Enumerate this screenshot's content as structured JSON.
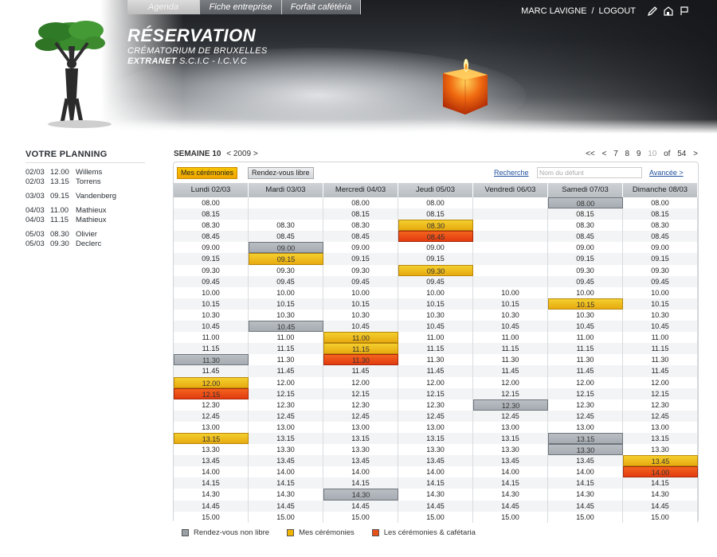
{
  "header": {
    "tabs": [
      "Agenda",
      "Fiche entreprise",
      "Forfait cafétéria"
    ],
    "title": "RÉSERVATION",
    "subtitle1": "CRÉMATORIUM DE BRUXELLES",
    "subtitle2_bold": "EXTRANET",
    "subtitle2_rest": " S.C.I.C - I.C.V.C",
    "user": "MARC LAVIGNE",
    "sep": "/",
    "logout": "LOGOUT"
  },
  "sidebar": {
    "title": "VOTRE PLANNING",
    "groups": [
      [
        {
          "d": "02/03",
          "t": "12.00",
          "n": "Willems"
        },
        {
          "d": "02/03",
          "t": "13.15",
          "n": "Torrens"
        }
      ],
      [
        {
          "d": "03/03",
          "t": "09.15",
          "n": "Vandenberg"
        }
      ],
      [
        {
          "d": "04/03",
          "t": "11.00",
          "n": "Mathieux"
        },
        {
          "d": "04/03",
          "t": "11.15",
          "n": "Mathieux"
        }
      ],
      [
        {
          "d": "05/03",
          "t": "08.30",
          "n": "Olivier"
        },
        {
          "d": "05/03",
          "t": "09.30",
          "n": "Declerc"
        }
      ]
    ]
  },
  "week": {
    "label": "SEMAINE 10",
    "year": "< 2009 >",
    "pager": [
      "<<",
      "<",
      "7",
      "8",
      "9",
      "10",
      "of",
      "54",
      ">"
    ]
  },
  "toolbar": {
    "mes": "Mes cérémonies",
    "rdv": "Rendez-vous libre",
    "recherche": "Recherche",
    "search_placeholder": "Nom du défunt",
    "avancee": "Avancée >"
  },
  "days": [
    "Lundi 02/03",
    "Mardi 03/03",
    "Mercredi 04/03",
    "Jeudi 05/03",
    "Vendredi 06/03",
    "Samedi 07/03",
    "Dimanche 08/03"
  ],
  "times": [
    "08.00",
    "08.15",
    "08.30",
    "08.45",
    "09.00",
    "09.15",
    "09.30",
    "09.45",
    "10.00",
    "10.15",
    "10.30",
    "10.45",
    "11.00",
    "11.15",
    "11.30",
    "11.45",
    "12.00",
    "12.15",
    "12.30",
    "12.45",
    "13.00",
    "13.15",
    "13.30",
    "13.45",
    "14.00",
    "14.15",
    "14.30",
    "14.45",
    "15.00"
  ],
  "empty": {
    "Mardi 03/03": [
      "08.00",
      "08.15"
    ],
    "Vendredi 06/03": [
      "08.00",
      "08.15",
      "08.30",
      "08.45",
      "09.00",
      "09.15",
      "09.30",
      "09.45"
    ]
  },
  "status": {
    "Lundi 02/03": {
      "11.30": "gray",
      "12.00": "yellow",
      "12.15": "orange",
      "13.15": "yellow"
    },
    "Mardi 03/03": {
      "09.00": "gray",
      "09.15": "yellow",
      "10.45": "gray"
    },
    "Mercredi 04/03": {
      "11.00": "yellow",
      "11.15": "yellow",
      "11.30": "orange",
      "14.30": "gray"
    },
    "Jeudi 05/03": {
      "08.30": "yellow",
      "08.45": "orange",
      "09.30": "yellow"
    },
    "Vendredi 06/03": {
      "12.30": "gray"
    },
    "Samedi 07/03": {
      "08.00": "gray",
      "10.15": "yellow",
      "13.15": "gray",
      "13.30": "gray"
    },
    "Dimanche 08/03": {
      "13.45": "yellow",
      "14.00": "orange"
    }
  },
  "legend": [
    {
      "label": "Rendez-vous non libre",
      "color": "#9aa0a6"
    },
    {
      "label": "Mes cérémonies",
      "color": "#f0b400"
    },
    {
      "label": "Les cérémonies & cafétaria",
      "color": "#e8501a"
    }
  ]
}
